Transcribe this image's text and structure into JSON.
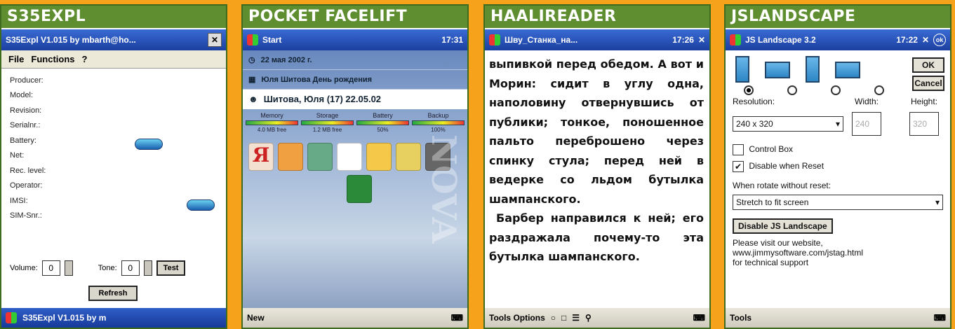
{
  "panels": {
    "s35expl": {
      "title": "S35EXPL",
      "window_title": "S35Expl V1.015 by mbarth@ho...",
      "menu": [
        "File",
        "Functions",
        "?"
      ],
      "fields": [
        "Producer:",
        "Model:",
        "Revision:",
        "Serialnr.:",
        "Battery:",
        "Net:",
        "Rec. level:",
        "Operator:",
        "IMSI:",
        "SIM-Snr.:"
      ],
      "volume_label": "Volume:",
      "volume_value": "0",
      "tone_label": "Tone:",
      "tone_value": "0",
      "test_button": "Test",
      "refresh_button": "Refresh",
      "taskbar": "S35Expl V1.015 by m"
    },
    "pocket_facelift": {
      "title": "POCKET FACELIFT",
      "start_label": "Start",
      "time": "17:31",
      "date_row": "22 мая 2002 г.",
      "event_row": "Юля Шитова День рождения",
      "contact_row": "Шитова, Юля (17)  22.05.02",
      "meters": [
        {
          "label": "Memory",
          "sub": "4.0 MB free"
        },
        {
          "label": "Storage",
          "sub": "1.2 MB free"
        },
        {
          "label": "Battery",
          "sub": "50%"
        },
        {
          "label": "Backup",
          "sub": "100%"
        }
      ],
      "vertical_text": "NOVA",
      "new_label": "New"
    },
    "haalireader": {
      "title": "HAALIREADER",
      "window_title": "Шву_Станка_на...",
      "time": "17:26",
      "paragraph1": "выпивкой перед обедом. А вот и Морин: сидит в углу одна, наполовину отвернувшись от публики; тонкое, поношенное пальто переброшено через спинку стула; перед ней в ведерке со льдом бутылка шампанского.",
      "paragraph2": "Барбер направился к ней; его раздражала почему-то эта бутылка шампанского.",
      "toolbar": "Tools Options"
    },
    "jslandscape": {
      "title": "JSLANDSCAPE",
      "window_title": "JS Landscape 3.2",
      "time": "17:22",
      "ok_button": "OK",
      "cancel_button": "Cancel",
      "resolution_label": "Resolution:",
      "resolution_value": "240 x 320",
      "width_label": "Width:",
      "width_value": "240",
      "height_label": "Height:",
      "height_value": "320",
      "control_box": "Control Box",
      "disable_when_reset": "Disable when Reset",
      "rotate_label": "When rotate without reset:",
      "rotate_value": "Stretch to fit screen",
      "disable_button": "Disable JS Landscape",
      "website_line1": "Please visit our website,",
      "website_line2": "www.jimmysoftware.com/jstag.html",
      "website_line3": "for technical support",
      "tools_label": "Tools"
    }
  }
}
